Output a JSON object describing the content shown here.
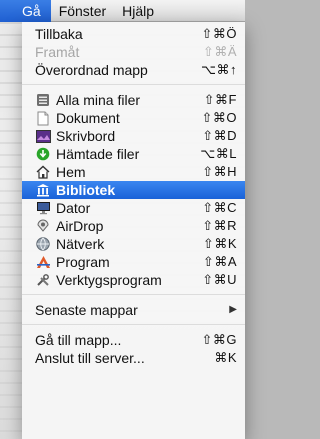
{
  "menubar": {
    "items": [
      {
        "label": "Gå",
        "active": true
      },
      {
        "label": "Fönster"
      },
      {
        "label": "Hjälp"
      }
    ]
  },
  "menu": {
    "group1": [
      {
        "label": "Tillbaka",
        "shortcut": "⇧⌘Ö",
        "enabled": true
      },
      {
        "label": "Framåt",
        "shortcut": "⇧⌘Ä",
        "enabled": false
      },
      {
        "label": "Överordnad mapp",
        "shortcut": "⌥⌘↑",
        "enabled": true
      }
    ],
    "places": [
      {
        "label": "Alla mina filer",
        "shortcut": "⇧⌘F",
        "icon": "all-files-icon"
      },
      {
        "label": "Dokument",
        "shortcut": "⇧⌘O",
        "icon": "document-icon"
      },
      {
        "label": "Skrivbord",
        "shortcut": "⇧⌘D",
        "icon": "desktop-icon"
      },
      {
        "label": "Hämtade filer",
        "shortcut": "⌥⌘L",
        "icon": "download-icon"
      },
      {
        "label": "Hem",
        "shortcut": "⇧⌘H",
        "icon": "home-icon"
      },
      {
        "label": "Bibliotek",
        "shortcut": "",
        "icon": "library-icon",
        "selected": true
      },
      {
        "label": "Dator",
        "shortcut": "⇧⌘C",
        "icon": "computer-icon"
      },
      {
        "label": "AirDrop",
        "shortcut": "⇧⌘R",
        "icon": "airdrop-icon"
      },
      {
        "label": "Nätverk",
        "shortcut": "⇧⌘K",
        "icon": "network-icon"
      },
      {
        "label": "Program",
        "shortcut": "⇧⌘A",
        "icon": "applications-icon"
      },
      {
        "label": "Verktygsprogram",
        "shortcut": "⇧⌘U",
        "icon": "utilities-icon"
      }
    ],
    "recent": {
      "label": "Senaste mappar",
      "submenu_icon": "▶"
    },
    "group4": [
      {
        "label": "Gå till mapp...",
        "shortcut": "⇧⌘G"
      },
      {
        "label": "Anslut till server...",
        "shortcut": "⌘K"
      }
    ]
  },
  "colors": {
    "highlight": "#1f63d8",
    "disabled_text": "#a6a6a6"
  }
}
